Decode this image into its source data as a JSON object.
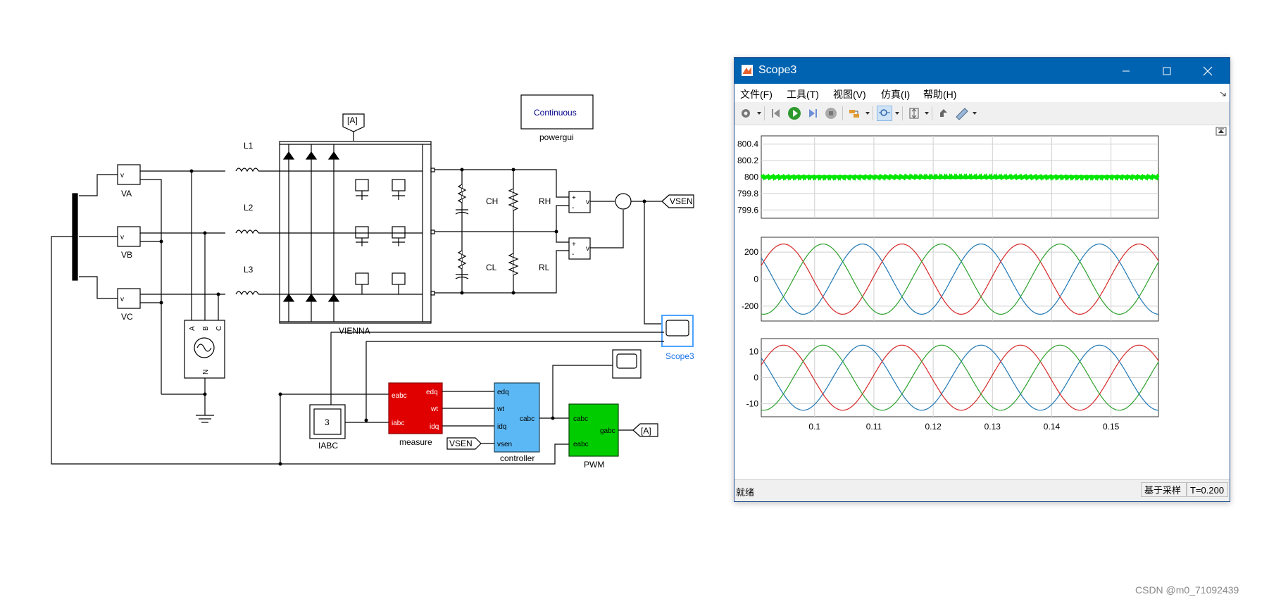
{
  "diagram": {
    "sources": [
      "VA",
      "VB",
      "VC"
    ],
    "inductors": [
      "L1",
      "L2",
      "L3"
    ],
    "goto_tag": "[A]",
    "powergui_block": "Continuous",
    "powergui_label": "powergui",
    "rectifier_label": "VIENNA",
    "capacitors": [
      "CH",
      "CL"
    ],
    "resistors": [
      "RH",
      "RL"
    ],
    "vsen_tag": "VSEN",
    "iabc_value": "3",
    "iabc_label": "IABC",
    "measure": {
      "label": "measure",
      "inputs": [
        "eabc",
        "iabc"
      ],
      "outputs": [
        "edq",
        "wt",
        "idq"
      ]
    },
    "controller": {
      "label": "controller",
      "inputs": [
        "edq",
        "wt",
        "idq",
        "vsen"
      ],
      "output": "cabc"
    },
    "pwm": {
      "label": "PWM",
      "inputs": [
        "cabc",
        "eabc"
      ],
      "output": "gabc"
    },
    "scope_label": "Scope3",
    "vm_port": "v",
    "plus": "+",
    "minus": "-",
    "source_ports": [
      "A",
      "B",
      "C",
      "N"
    ]
  },
  "scope_window": {
    "title": "Scope3",
    "menu": [
      "文件(F)",
      "工具(T)",
      "视图(V)",
      "仿真(I)",
      "帮助(H)"
    ],
    "toolbar_icons": [
      "gear-icon",
      "step-back-icon",
      "run-icon",
      "step-forward-icon",
      "stop-icon",
      "highlight-icon",
      "zoom-icon",
      "autoscale-icon",
      "cursor-icon",
      "measure-icon"
    ],
    "status_left": "就绪",
    "status_mode": "基于采样",
    "status_time": "T=0.200",
    "plots": [
      {
        "yticks": [
          "800.4",
          "800.2",
          "800",
          "799.8",
          "799.6"
        ]
      },
      {
        "yticks": [
          "200",
          "0",
          "-200"
        ]
      },
      {
        "yticks": [
          "10",
          "0",
          "-10"
        ]
      }
    ],
    "xticks": [
      "0.1",
      "0.11",
      "0.12",
      "0.13",
      "0.14",
      "0.15"
    ],
    "colors": {
      "dc": "#00e600",
      "a": "#1f77b4",
      "b": "#d62728",
      "c": "#2ca02c"
    }
  },
  "chart_data": [
    {
      "type": "line",
      "series": [
        {
          "values": [
            800,
            800,
            800
          ]
        }
      ],
      "x": [
        0.091,
        0.125,
        0.158
      ],
      "ylim": [
        799.5,
        800.5
      ],
      "grid": true
    },
    {
      "type": "line",
      "x_range": [
        0.091,
        0.158
      ],
      "amplitude": 260,
      "frequency_hz": 50,
      "ylim": [
        -310,
        310
      ],
      "grid": true,
      "series": [
        {
          "values": []
        },
        {
          "values": []
        },
        {
          "values": []
        }
      ]
    },
    {
      "type": "line",
      "x_range": [
        0.091,
        0.158
      ],
      "amplitude": 12.5,
      "frequency_hz": 50,
      "ylim": [
        -15,
        15
      ],
      "grid": true,
      "series": [
        {
          "values": []
        },
        {
          "values": []
        },
        {
          "values": []
        }
      ]
    }
  ],
  "watermark": "CSDN @m0_71092439"
}
